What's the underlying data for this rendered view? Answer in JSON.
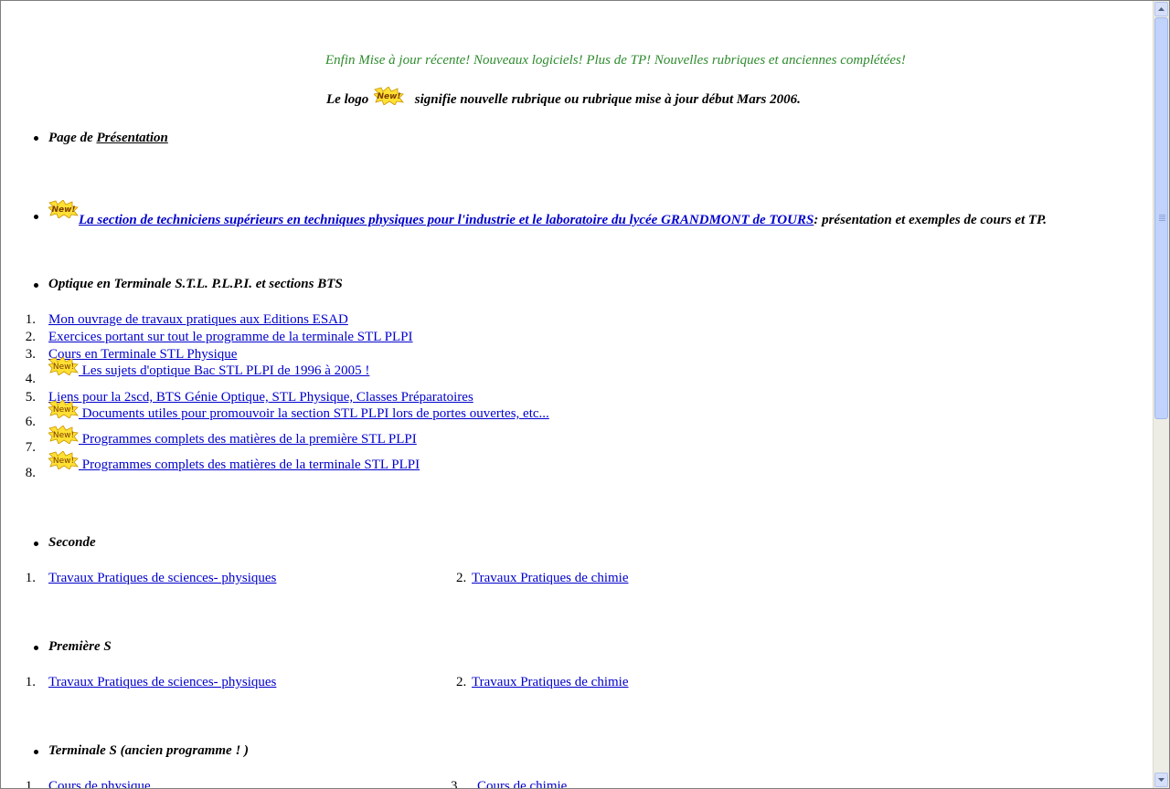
{
  "header": {
    "update_notice": "Enfin Mise à jour récente! Nouveaux logiciels! Plus de TP! Nouvelles rubriques et anciennes complétées!",
    "logo_prefix": "Le logo",
    "logo_suffix": "signifie nouvelle rubrique ou rubrique mise à jour début Mars 2006."
  },
  "presentation": {
    "prefix": "Page de ",
    "link": "Présentation"
  },
  "bts_section": {
    "link": "La section de techniciens supérieurs en techniques physiques pour l'industrie et le laboratoire du lycée GRANDMONT de TOURS",
    "suffix": ": présentation et exemples de cours et TP."
  },
  "optique": {
    "heading": "Optique en Terminale S.T.L. P.L.P.I. et sections BTS",
    "items": [
      {
        "num": "1.",
        "label": "Mon ouvrage de travaux pratiques aux Editions ESAD ",
        "new": false
      },
      {
        "num": "2.",
        "label": "Exercices portant sur tout le programme de la terminale STL PLPI",
        "new": false
      },
      {
        "num": "3.",
        "label": "Cours en Terminale STL Physique",
        "new": false
      },
      {
        "num": "4.",
        "label": " Les sujets d'optique Bac STL PLPI de 1996 à 2005 !",
        "new": true
      },
      {
        "num": "5.",
        "label": "Liens pour la 2scd, BTS Génie Optique, STL Physique, Classes Préparatoires",
        "new": false
      },
      {
        "num": "6.",
        "label": " Documents utiles pour promouvoir la section STL PLPI lors de portes ouvertes, etc...",
        "new": true
      },
      {
        "num": "7.",
        "label": " Programmes complets des matières de la première STL PLPI",
        "new": true
      },
      {
        "num": "8.",
        "label": " Programmes complets des matières de la terminale STL PLPI",
        "new": true
      }
    ]
  },
  "seconde": {
    "heading": "Seconde",
    "left_num": "1.",
    "left_label": "Travaux Pratiques de sciences- physiques",
    "right_num": "2.",
    "right_label": "Travaux Pratiques de chimie"
  },
  "premiere": {
    "heading": "Première S",
    "left_num": "1.",
    "left_label": "Travaux Pratiques de sciences- physiques",
    "right_num": "2.",
    "right_label": "Travaux Pratiques de chimie"
  },
  "terminale": {
    "heading": "Terminale S (ancien programme ! )",
    "left_num": "1.",
    "left_label": "Cours de physique",
    "right_num": "3.",
    "right_label": "Cours de chimie"
  },
  "new_logo_text": "New!",
  "colors": {
    "notice": "#2e8b2e",
    "link": "#0000cc",
    "logo_fill": "#ffe033"
  }
}
